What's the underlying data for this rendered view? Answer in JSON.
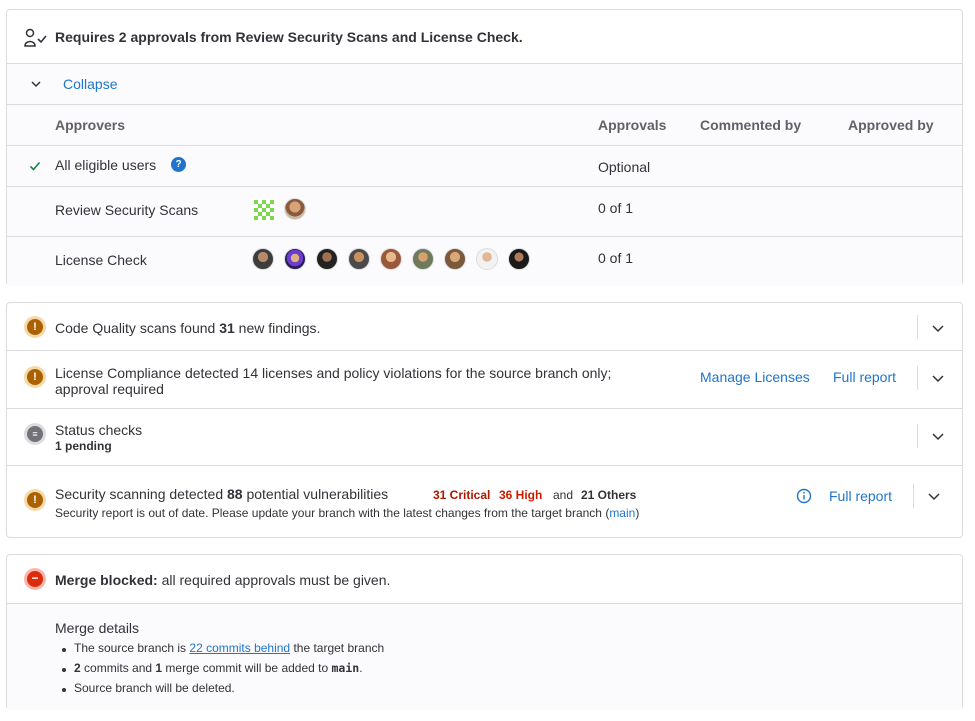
{
  "approvals": {
    "title": "Requires 2 approvals from Review Security Scans and License Check.",
    "collapse_label": "Collapse",
    "headers": {
      "approvers": "Approvers",
      "approvals": "Approvals",
      "commented_by": "Commented by",
      "approved_by": "Approved by"
    },
    "rows": [
      {
        "name": "All eligible users",
        "approvals": "Optional"
      },
      {
        "name": "Review Security Scans",
        "approvals": "0 of 1"
      },
      {
        "name": "License Check",
        "approvals": "0 of 1"
      }
    ]
  },
  "widgets": {
    "code_quality": {
      "prefix": "Code Quality scans found ",
      "count": "31",
      "suffix": " new findings."
    },
    "license": {
      "line1": "License Compliance detected 14 licenses and policy violations for the source branch only;",
      "line2": "approval required",
      "manage_label": "Manage Licenses",
      "report_label": "Full report"
    },
    "status_checks": {
      "title": "Status checks",
      "subtitle": "1 pending"
    },
    "security": {
      "prefix": "Security scanning detected ",
      "count": "88",
      "suffix": " potential vulnerabilities",
      "critical": "31 Critical",
      "high": "36 High",
      "and_label": "and",
      "others": "21 Others",
      "note_prefix": "Security report is out of date. Please update your branch with the latest changes from the target branch (",
      "note_branch": "main",
      "note_suffix": ")",
      "report_label": "Full report"
    }
  },
  "merge": {
    "blocked_label": "Merge blocked:",
    "blocked_text": " all required approvals must be given.",
    "details_title": "Merge details",
    "items": {
      "behind_prefix": "The source branch is ",
      "behind_link": "22 commits behind",
      "behind_suffix": " the target branch",
      "commits_count": "2",
      "commits_mid": " commits and ",
      "merge_count": "1",
      "commits_end": " merge commit will be added to ",
      "target_branch": "main",
      "period": ".",
      "delete_note": "Source branch will be deleted."
    }
  },
  "colors": {
    "link": "#1f75cb",
    "critical": "#ae1800",
    "high": "#c91c00",
    "success": "#108548",
    "warning": "#ab6100",
    "danger": "#dd2b0e"
  }
}
